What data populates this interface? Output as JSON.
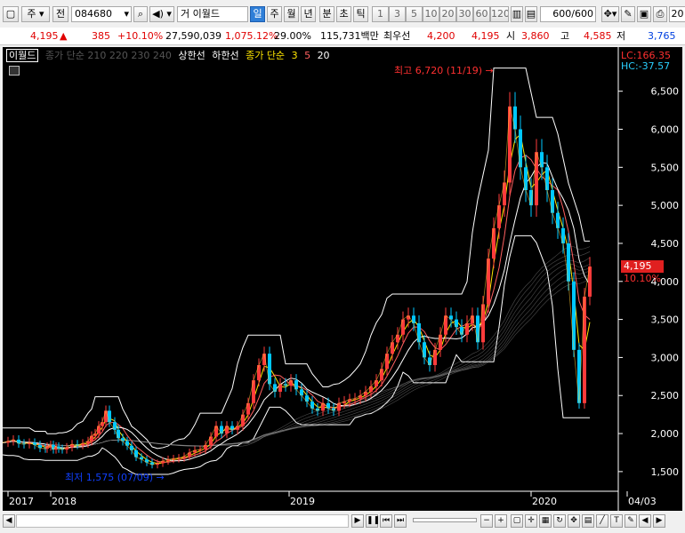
{
  "toolbar": {
    "market": "주",
    "prev": "전",
    "code": "084680",
    "name_prefix": "거",
    "name": "이월드",
    "periods": [
      "일",
      "주",
      "월",
      "년",
      "분",
      "초",
      "틱"
    ],
    "active_period": "일",
    "tick_values": [
      "1",
      "3",
      "5",
      "10",
      "20",
      "30",
      "60",
      "120"
    ],
    "count": "600",
    "count_total": "/600",
    "edge_label": "20"
  },
  "quote": {
    "price": "4,195",
    "change_arrow": "▲",
    "change": "385",
    "change_pct": "+10.10%",
    "volume": "27,590,039",
    "volume_pct": "1,075.12%",
    "turnover": "29.00%",
    "amount": "115,731백만",
    "best_ask_label": "최우선",
    "best_ask": "4,200",
    "best_bid": "4,195",
    "open_label": "시",
    "open": "3,860",
    "high_label": "고",
    "high": "4,585",
    "low_label": "저",
    "low": "3,765"
  },
  "chart": {
    "legend": {
      "item_name": "이월드",
      "ma_main": "종가 단순 210 220 230 240",
      "upper_limit": "상한선",
      "lower_limit": "하한선",
      "ma_short_label": "종가 단순",
      "ma_short_periods": [
        "3",
        "5",
        "20"
      ]
    },
    "high_note": "최고 6,720 (11/19)",
    "low_note": "최저 1,575 (07/09)",
    "price_box": "4,195",
    "price_box_pct": "10.10%",
    "lc": "LC:166.35",
    "hc": "HC:-37.57",
    "date_labels": [
      {
        "label": "2017",
        "x": 6
      },
      {
        "label": "2018",
        "x": 54
      },
      {
        "label": "2019",
        "x": 322
      },
      {
        "label": "2020",
        "x": 594
      },
      {
        "label": "04/03",
        "x": 702
      }
    ],
    "colors": {
      "up": "#ff3b3b",
      "down": "#00c8ff",
      "band": "#ffffff",
      "ma": "#ffe600",
      "bg": "#000000"
    }
  },
  "chart_data": {
    "type": "line",
    "title": "이월드",
    "ylim": [
      1300,
      6800
    ],
    "y_ticks": [
      1500,
      2000,
      2500,
      3000,
      3500,
      4000,
      4500,
      5000,
      5500,
      6000,
      6500
    ],
    "x_ticks": [
      "2017",
      "2018",
      "2019",
      "2020",
      "04/03"
    ],
    "series": [
      {
        "name": "종가",
        "x": [
          0,
          6,
          12,
          18,
          24,
          30,
          36,
          42,
          48,
          50,
          54,
          57,
          60,
          63,
          67,
          72,
          78,
          84,
          90,
          96,
          100,
          104,
          108,
          112,
          116,
          120,
          126,
          130,
          135,
          140,
          145,
          150,
          156,
          162,
          168,
          174,
          180,
          186,
          192,
          198,
          204,
          210,
          216,
          222,
          228,
          234,
          240,
          246,
          252,
          258,
          264,
          270,
          276,
          282,
          288,
          294,
          300,
          306,
          312,
          318,
          324,
          330,
          336,
          342,
          348,
          354,
          360,
          366,
          372,
          378,
          384,
          390,
          396,
          402,
          408,
          414,
          420,
          426,
          432,
          438,
          444,
          450,
          456,
          462,
          468,
          474,
          480,
          486,
          492,
          498,
          504,
          510,
          516,
          522,
          528,
          534,
          540,
          546,
          552,
          558,
          564,
          570,
          576,
          582,
          588,
          594,
          600,
          606,
          612,
          618,
          624,
          630,
          636,
          642,
          648,
          654,
          660
        ],
        "values": [
          1880,
          1900,
          1920,
          1870,
          1860,
          1880,
          1850,
          1810,
          1800,
          1830,
          1850,
          1790,
          1830,
          1800,
          1790,
          1820,
          1860,
          1850,
          1870,
          1900,
          1970,
          2000,
          2100,
          2150,
          2300,
          2150,
          2050,
          1940,
          1900,
          1840,
          1780,
          1690,
          1660,
          1620,
          1590,
          1610,
          1640,
          1660,
          1670,
          1680,
          1700,
          1750,
          1780,
          1790,
          1850,
          1960,
          2100,
          2000,
          2100,
          2050,
          2100,
          2250,
          2400,
          2700,
          2900,
          3050,
          2650,
          2550,
          2650,
          2630,
          2700,
          2580,
          2500,
          2420,
          2330,
          2300,
          2400,
          2330,
          2300,
          2400,
          2420,
          2450,
          2460,
          2500,
          2550,
          2620,
          2700,
          2850,
          3050,
          3200,
          3300,
          3500,
          3550,
          3450,
          3200,
          3000,
          2900,
          3100,
          3300,
          3550,
          3500,
          3400,
          3300,
          3450,
          3550,
          3200,
          3700,
          4300,
          4700,
          5000,
          5300,
          6300,
          6000,
          5500,
          5200,
          5000,
          5700,
          5500,
          5200,
          4900,
          4700,
          4500,
          4000,
          3100,
          2400,
          3800,
          4195
        ]
      }
    ]
  },
  "scrollbar": {
    "prev_symbol": "◀",
    "next_symbol": "▶",
    "play": "▶",
    "pause": "❚❚",
    "first": "⏮",
    "last": "⏭",
    "minus": "−",
    "plus": "+"
  }
}
